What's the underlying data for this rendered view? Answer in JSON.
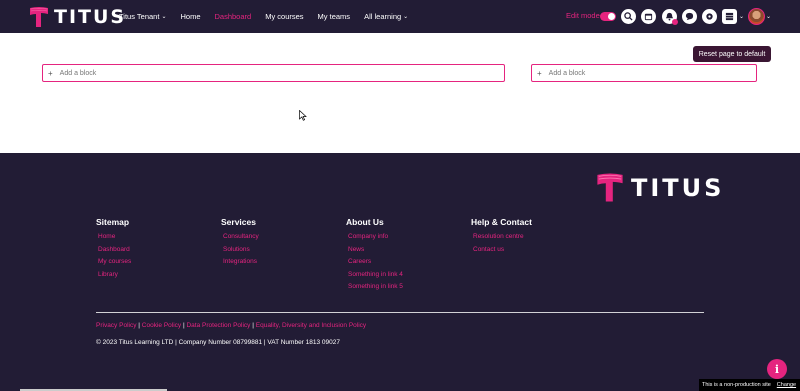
{
  "brand": {
    "name": "TITUS",
    "accent": "#e5247f",
    "dark": "#221c35"
  },
  "nav": {
    "items": [
      {
        "label": "Titus Tenant",
        "dropdown": true
      },
      {
        "label": "Home",
        "dropdown": false
      },
      {
        "label": "Dashboard",
        "dropdown": false,
        "active": true
      },
      {
        "label": "My courses",
        "dropdown": false
      },
      {
        "label": "My teams",
        "dropdown": false
      },
      {
        "label": "All learning",
        "dropdown": true
      }
    ],
    "edit_mode_label": "Edit mode",
    "edit_mode_on": true,
    "icons": [
      "search-icon",
      "calendar-icon",
      "notification-bell-icon",
      "chat-icon",
      "gear-icon",
      "grid-icon"
    ]
  },
  "main": {
    "reset_label": "Reset page to default",
    "add_block_label": "Add a block"
  },
  "footer": {
    "columns": [
      {
        "title": "Sitemap",
        "links": [
          "Home",
          "Dashboard",
          "My courses",
          "Library"
        ]
      },
      {
        "title": "Services",
        "links": [
          "Consultancy",
          "Solutions",
          "Integrations"
        ]
      },
      {
        "title": "About Us",
        "links": [
          "Company info",
          "News",
          "Careers",
          "Something in link 4",
          "Something in link 5"
        ]
      },
      {
        "title": "Help & Contact",
        "links": [
          "Resolution centre",
          "Contact us"
        ]
      }
    ],
    "policies": [
      "Privacy Policy",
      "Cookie Policy",
      "Data Protection Policy",
      "Equality, Diversity and Inclusion Policy"
    ],
    "copyright": "© 2023 Titus Learning LTD | Company Number 08799881 | VAT Number 1813 09027",
    "nonprod_text": "This is a non-production site",
    "change_label": "Change",
    "info_label": "i"
  }
}
